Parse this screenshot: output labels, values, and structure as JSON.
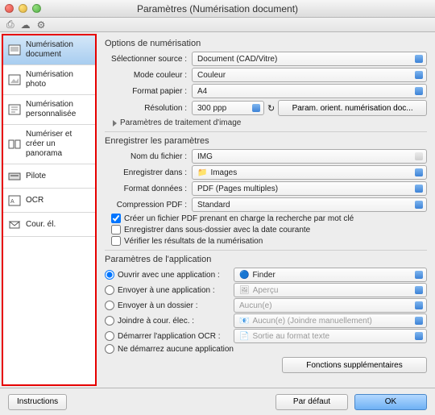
{
  "window": {
    "title": "Paramètres (Numérisation document)"
  },
  "sidebar": {
    "items": [
      {
        "label": "Numérisation document"
      },
      {
        "label": "Numérisation photo"
      },
      {
        "label": "Numérisation personnalisée"
      },
      {
        "label": "Numériser et créer un panorama"
      },
      {
        "label": "Pilote"
      },
      {
        "label": "OCR"
      },
      {
        "label": "Cour. él."
      }
    ]
  },
  "scan": {
    "section": "Options de numérisation",
    "source_label": "Sélectionner source :",
    "source_value": "Document (CAD/Vitre)",
    "colormode_label": "Mode couleur :",
    "colormode_value": "Couleur",
    "papersize_label": "Format papier :",
    "papersize_value": "A4",
    "resolution_label": "Résolution :",
    "resolution_value": "300 ppp",
    "orient_button": "Param. orient. numérisation doc...",
    "processing_label": "Paramètres de traitement d'image"
  },
  "save": {
    "section": "Enregistrer les paramètres",
    "filename_label": "Nom du fichier :",
    "filename_value": "IMG",
    "savein_label": "Enregistrer dans :",
    "savein_value": "Images",
    "format_label": "Format données :",
    "format_value": "PDF (Pages multiples)",
    "pdfcomp_label": "Compression PDF :",
    "pdfcomp_value": "Standard",
    "chk_keyword": "Créer un fichier PDF prenant en charge la recherche par mot clé",
    "chk_subfolder": "Enregistrer dans sous-dossier avec la date courante",
    "chk_verify": "Vérifier les résultats de la numérisation"
  },
  "app": {
    "section": "Paramètres de l'application",
    "open_with": "Ouvrir avec une application :",
    "open_with_value": "Finder",
    "send_to_app": "Envoyer à une application :",
    "send_to_app_value": "Aperçu",
    "send_to_folder": "Envoyer à un dossier :",
    "send_to_folder_value": "Aucun(e)",
    "attach_mail": "Joindre à cour. élec. :",
    "attach_mail_value": "Aucun(e) (Joindre manuellement)",
    "start_ocr": "Démarrer l'application OCR :",
    "start_ocr_value": "Sortie au format texte",
    "start_none": "Ne démarrez aucune application",
    "extra_button": "Fonctions supplémentaires"
  },
  "footer": {
    "instructions": "Instructions",
    "defaults": "Par défaut",
    "ok": "OK"
  }
}
